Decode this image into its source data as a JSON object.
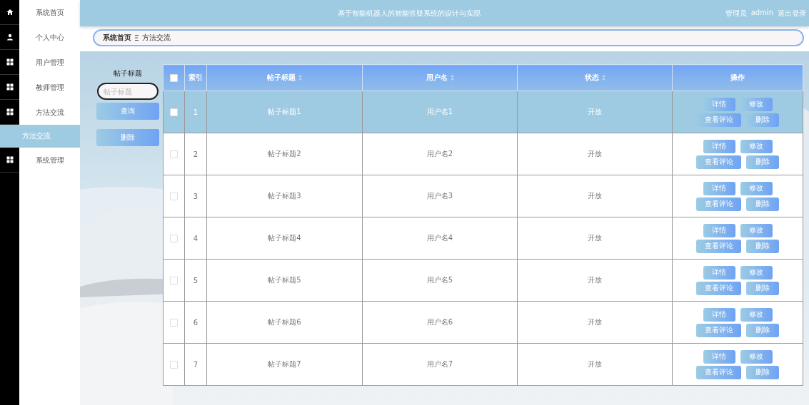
{
  "header": {
    "title": "基于智能机器人的智能答疑系统的设计与实现",
    "role": "管理员",
    "username": "admin",
    "logout": "退出登录"
  },
  "sidebar": {
    "items": [
      {
        "label": "系统首页",
        "selected": false
      },
      {
        "label": "个人中心",
        "selected": false
      },
      {
        "label": "用户管理",
        "selected": false
      },
      {
        "label": "教师管理",
        "selected": false
      },
      {
        "label": "方法交流",
        "selected": false,
        "children": [
          {
            "label": "方法交流",
            "selected": true
          }
        ]
      },
      {
        "label": "系统管理",
        "selected": false
      }
    ]
  },
  "breadcrumb": [
    "系统首页",
    "方法交流"
  ],
  "search": {
    "label": "帖子标题",
    "placeholder": "帖子标题",
    "buttons": [
      "查询",
      "删除"
    ]
  },
  "table": {
    "select_all_checked": false,
    "columns": [
      {
        "label": "索引",
        "sortable": false
      },
      {
        "label": "帖子标题",
        "sortable": true
      },
      {
        "label": "用户名",
        "sortable": true
      },
      {
        "label": "状态",
        "sortable": true
      },
      {
        "label": "操作",
        "sortable": false
      }
    ],
    "rows": [
      {
        "selected": true,
        "checked": false,
        "cells": [
          "1",
          "帖子标题1",
          "用户名1",
          "开放"
        ],
        "actions": [
          "详情",
          "修改",
          "查看评论",
          "删除"
        ]
      },
      {
        "selected": false,
        "checked": false,
        "cells": [
          "2",
          "帖子标题2",
          "用户名2",
          "开放"
        ],
        "actions": [
          "详情",
          "修改",
          "查看评论",
          "删除"
        ]
      },
      {
        "selected": false,
        "checked": false,
        "cells": [
          "3",
          "帖子标题3",
          "用户名3",
          "开放"
        ],
        "actions": [
          "详情",
          "修改",
          "查看评论",
          "删除"
        ]
      },
      {
        "selected": false,
        "checked": false,
        "cells": [
          "4",
          "帖子标题4",
          "用户名4",
          "开放"
        ],
        "actions": [
          "详情",
          "修改",
          "查看评论",
          "删除"
        ]
      },
      {
        "selected": false,
        "checked": false,
        "cells": [
          "5",
          "帖子标题5",
          "用户名5",
          "开放"
        ],
        "actions": [
          "详情",
          "修改",
          "查看评论",
          "删除"
        ]
      },
      {
        "selected": false,
        "checked": false,
        "cells": [
          "6",
          "帖子标题6",
          "用户名6",
          "开放"
        ],
        "actions": [
          "详情",
          "修改",
          "查看评论",
          "删除"
        ]
      },
      {
        "selected": false,
        "checked": false,
        "cells": [
          "7",
          "帖子标题7",
          "用户名7",
          "开放"
        ],
        "actions": [
          "详情",
          "修改",
          "查看评论",
          "删除"
        ]
      }
    ]
  }
}
